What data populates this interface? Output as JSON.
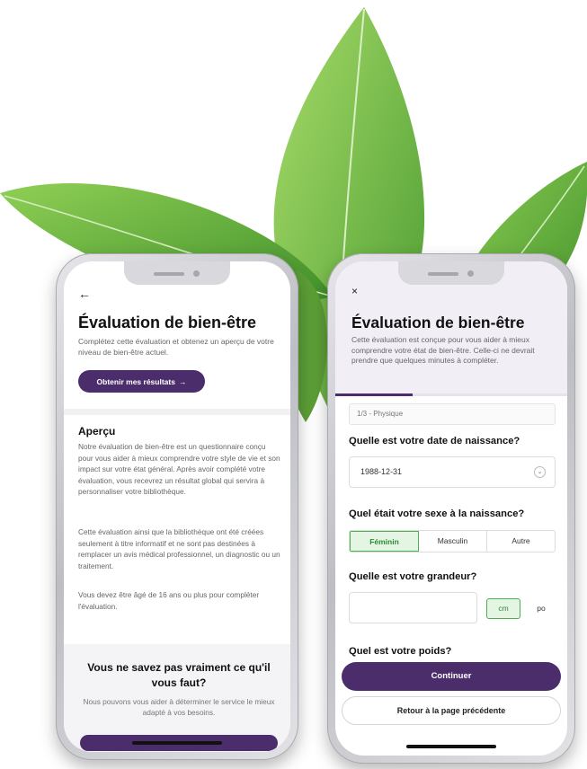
{
  "colors": {
    "brand_purple": "#4b2d6b",
    "selected_green": "#4caf50",
    "selected_green_bg": "#e4f5e4",
    "leaf_green": "#5fa833"
  },
  "background": {
    "icon": "leaves-illustration"
  },
  "phone1": {
    "back_icon": "←",
    "title": "Évaluation de bien-être",
    "subtitle": "Complétez cette évaluation et obtenez un aperçu de votre niveau de bien-être actuel.",
    "results_button": "Obtenir mes résultats",
    "results_arrow": "→",
    "overview_heading": "Aperçu",
    "overview_paragraphs": [
      "Notre évaluation de bien-être est un questionnaire conçu pour vous aider à mieux comprendre votre style de vie et son impact sur votre état général. Après avoir complété votre évaluation, vous recevrez un résultat global qui servira à personnaliser votre bibliothèque.",
      "Cette évaluation ainsi que la bibliothèque ont été créées seulement à titre informatif et ne sont pas destinées à remplacer un avis médical professionnel, un diagnostic ou un traitement.",
      "Vous devez être âgé de 16 ans ou plus pour compléter l'évaluation."
    ],
    "cta_title": "Vous ne savez pas vraiment ce qu'il vous faut?",
    "cta_subtitle": "Nous pouvons vous aider à déterminer le service le mieux adapté à vos besoins."
  },
  "phone2": {
    "close_icon": "×",
    "title": "Évaluation de bien-être",
    "subtitle": "Cette évaluation est conçue pour vous aider à mieux comprendre votre état de bien-être. Celle-ci ne devrait prendre que quelques minutes à compléter.",
    "progress": 0.333,
    "step_label": "1/3 - Physique",
    "q_birthdate": "Quelle est votre date de naissance?",
    "birthdate_value": "1988-12-31",
    "chevron_icon": "⌄",
    "q_sex": "Quel était votre sexe à la naissance?",
    "sex_options": [
      "Féminin",
      "Masculin",
      "Autre"
    ],
    "sex_selected": "Féminin",
    "q_height": "Quelle est votre grandeur?",
    "height_value": "",
    "units": [
      "cm",
      "po"
    ],
    "unit_selected": "cm",
    "q_weight": "Quel est votre poids?",
    "continue_button": "Continuer",
    "back_button": "Retour à la page précédente"
  }
}
